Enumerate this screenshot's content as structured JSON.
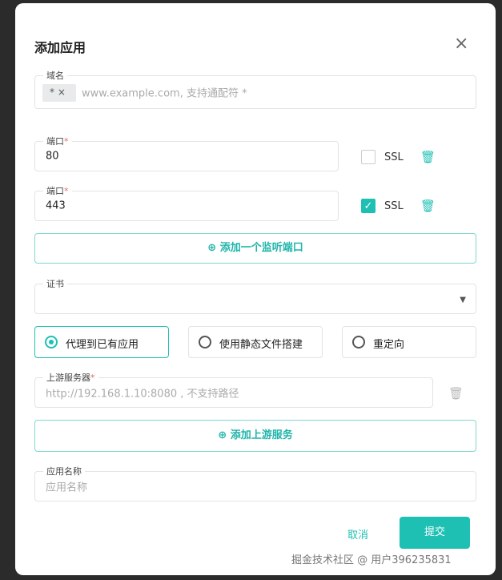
{
  "dialog": {
    "title": "添加应用",
    "close": "×"
  },
  "domain": {
    "label": "域名",
    "chip": "* ×",
    "placeholder": "www.example.com, 支持通配符 *"
  },
  "ports": [
    {
      "label": "端口",
      "required": "*",
      "value": "80",
      "ssl_label": "SSL",
      "ssl_checked": false
    },
    {
      "label": "端口",
      "required": "*",
      "value": "443",
      "ssl_label": "SSL",
      "ssl_checked": true
    }
  ],
  "add_port": "⊕  添加一个监听端口",
  "cert": {
    "label": "证书",
    "value": ""
  },
  "modes": [
    {
      "label": "代理到已有应用",
      "selected": true
    },
    {
      "label": "使用静态文件搭建",
      "selected": false
    },
    {
      "label": "重定向",
      "selected": false
    }
  ],
  "upstream": {
    "label": "上游服务器",
    "required": "*",
    "placeholder": "http://192.168.1.10:8080 , 不支持路径"
  },
  "add_upstream": "⊕  添加上游服务",
  "app_name": {
    "label": "应用名称",
    "placeholder": "应用名称"
  },
  "footer": {
    "cancel": "取消",
    "submit": "提交"
  },
  "watermark": "掘金技术社区 @ 用户396235831",
  "colors": {
    "accent": "#1fc0b4"
  }
}
